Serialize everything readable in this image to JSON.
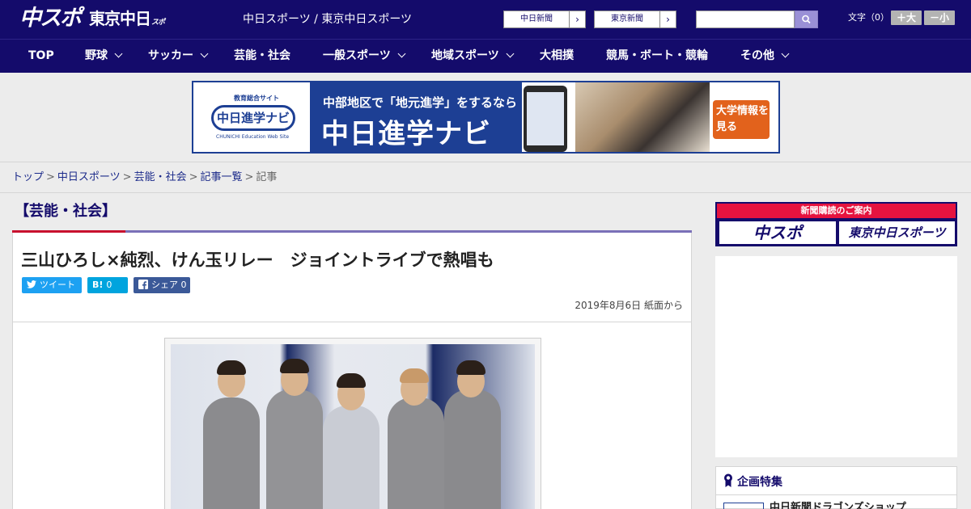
{
  "header": {
    "logo_chuspo": "中スポ",
    "logo_tokyo": "東京中日",
    "logo_tokyo_suffix": "スポーツ",
    "site_title": "中日スポーツ / 東京中日スポーツ",
    "ext_links": [
      {
        "label": "中日新聞",
        "arrow": "›"
      },
      {
        "label": "東京新聞",
        "arrow": "›"
      }
    ],
    "search": {
      "value": "",
      "placeholder": ""
    },
    "text_size_label": "文字（0）",
    "text_larger": "＋大",
    "text_smaller": "－小"
  },
  "nav": {
    "items": [
      {
        "label": "TOP",
        "dropdown": false
      },
      {
        "label": "野球",
        "dropdown": true
      },
      {
        "label": "サッカー",
        "dropdown": true
      },
      {
        "label": "芸能・社会",
        "dropdown": false
      },
      {
        "label": "一般スポーツ",
        "dropdown": true
      },
      {
        "label": "地域スポーツ",
        "dropdown": true
      },
      {
        "label": "大相撲",
        "dropdown": false
      },
      {
        "label": "競馬・ボート・競輪",
        "dropdown": false
      },
      {
        "label": "その他",
        "dropdown": true
      }
    ]
  },
  "banner": {
    "logo_tag": "教育総合サイト",
    "logo_name": "中日進学ナビ",
    "logo_sub": "CHUNICHI Education Web Site",
    "line1": "中部地区で「地元進学」をするなら",
    "line2": "中日進学ナビ",
    "cta": "大学情報を見る"
  },
  "breadcrumb": {
    "items": [
      "トップ",
      "中日スポーツ",
      "芸能・社会",
      "記事一覧"
    ],
    "current": "記事",
    "separator": ">"
  },
  "article": {
    "category": "【芸能・社会】",
    "title": "三山ひろし×純烈、けん玉リレー　ジョイントライブで熱唱も",
    "share": {
      "tweet": "ツイート",
      "hatena_icon": "B!",
      "hatena_count": "0",
      "facebook": "シェア",
      "facebook_count": "0"
    },
    "date": "2019年8月6日 紙面から"
  },
  "sidebar": {
    "subscribe_title": "新聞購読のご案内",
    "subscribe_buttons": [
      "中スポ",
      "東京中日スポーツ"
    ],
    "special_title": "企画特集",
    "special_item": "中日新聞ドラゴンズショップ"
  },
  "colors": {
    "brand_navy": "#140b6b",
    "accent_red": "#c8102e",
    "twitter": "#1da1f2",
    "hatena": "#00a4de",
    "facebook": "#3b5998"
  }
}
